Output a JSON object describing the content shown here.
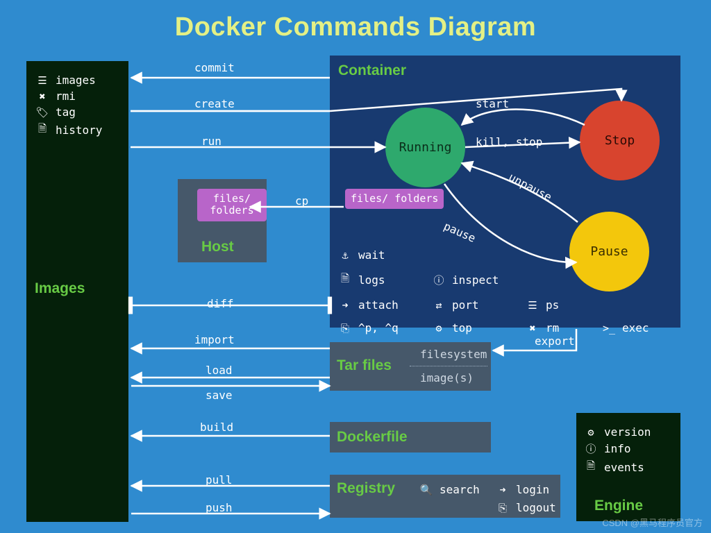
{
  "title": "Docker Commands Diagram",
  "sections": {
    "images": "Images",
    "container": "Container",
    "host": "Host",
    "tarfiles": "Tar files",
    "dockerfile": "Dockerfile",
    "registry": "Registry",
    "engine": "Engine"
  },
  "images_commands": [
    "images",
    "rmi",
    "tag",
    "history"
  ],
  "images_icons": [
    "list-icon",
    "x-icon",
    "tag-icon",
    "doc-icon"
  ],
  "container_states": {
    "running": "Running",
    "stop": "Stop",
    "pause": "Pause"
  },
  "container_cmds": {
    "r1": [
      "wait"
    ],
    "r2": [
      "logs",
      "inspect"
    ],
    "r3": [
      "attach",
      "port",
      "ps"
    ],
    "r4": [
      "^p, ^q",
      "top",
      "rm",
      "exec"
    ]
  },
  "state_edges": {
    "start": "start",
    "killstop": "kill, stop",
    "pause": "pause",
    "unpause": "unpause"
  },
  "flows": {
    "commit": "commit",
    "create": "create",
    "run": "run",
    "cp": "cp",
    "diff": "diff",
    "import": "import",
    "export": "export",
    "load": "load",
    "save": "save",
    "build": "build",
    "pull": "pull",
    "push": "push"
  },
  "tar_labels": {
    "fs": "filesystem",
    "img": "image(s)"
  },
  "filesfolders": "files/\nfolders",
  "registry_cmds": [
    "search",
    "login",
    "logout"
  ],
  "engine_cmds": [
    "version",
    "info",
    "events"
  ],
  "watermark": "CSDN @黑马程序员官方"
}
